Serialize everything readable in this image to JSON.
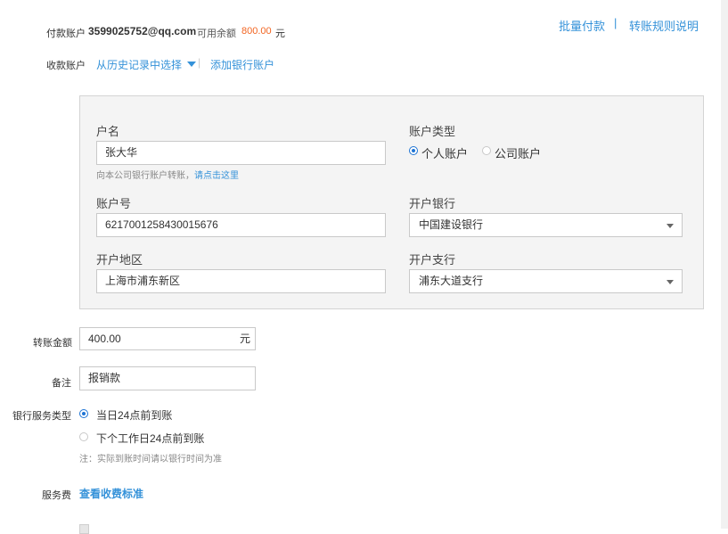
{
  "header": {
    "payer_label": "付款账户",
    "payer_account": "3599025752@qq.com",
    "balance_label": "可用余额",
    "balance_value": "800.00",
    "balance_unit": "元",
    "batch_pay_link": "批量付款",
    "divider": "|",
    "rules_link": "转账规则说明"
  },
  "payee": {
    "label": "收款账户",
    "history_link": "从历史记录中选择",
    "divider": "|",
    "add_bank_link": "添加银行账户"
  },
  "form": {
    "account_name_label": "户名",
    "account_name_value": "张大华",
    "company_hint": "向本公司银行账户转账，",
    "company_hint_link": "请点击这里",
    "account_type_label": "账户类型",
    "account_type_options": [
      "个人账户",
      "公司账户"
    ],
    "account_type_selected": "个人账户",
    "account_no_label": "账户号",
    "account_no_value": "6217001258430015676",
    "bank_label": "开户银行",
    "bank_value": "中国建设银行",
    "region_label": "开户地区",
    "region_value": "上海市浦东新区",
    "branch_label": "开户支行",
    "branch_value": "浦东大道支行"
  },
  "amount": {
    "label": "转账金额",
    "value": "400.00",
    "unit": "元"
  },
  "note": {
    "label": "备注",
    "value": "报销款"
  },
  "service_type": {
    "label": "银行服务类型",
    "options": [
      "当日24点前到账",
      "下个工作日24点前到账"
    ],
    "selected": "当日24点前到账",
    "note": "注：实际到账时间请以银行时间为准"
  },
  "fee": {
    "label": "服务费",
    "link": "查看收费标准"
  },
  "colors": {
    "link": "#3592d9",
    "accent_orange": "#f26522",
    "radio_blue": "#1f74d4",
    "panel_bg": "#f4f4f4"
  }
}
